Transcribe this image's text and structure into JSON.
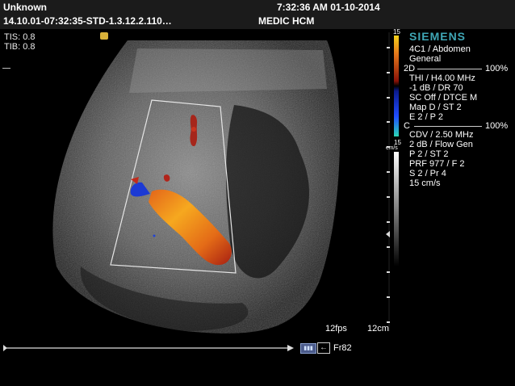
{
  "header": {
    "patient_name": "Unknown",
    "study_id": "14.10.01-07:32:35-STD-1.3.12.2.110…",
    "datetime": "7:32:36 AM 01-10-2014",
    "institution": "MEDIC HCM"
  },
  "safety": {
    "tis": "TIS: 0.8",
    "tib": "TIB: 0.8"
  },
  "branding": {
    "manufacturer": "SIEMENS",
    "brand_color": "#3fa6b5"
  },
  "scale": {
    "color_top": "15",
    "color_bottom": "15",
    "color_unit": "cm/s"
  },
  "params": {
    "transducer": "4C1 / Abdomen",
    "preset": "General",
    "mode_2d": "2D",
    "gain_2d": "100%",
    "line1": "THI / H4.00 MHz",
    "line2": "-1 dB / DR 70",
    "line3": "SC Off / DTCE M",
    "line4": "Map D / ST 2",
    "line5": "E 2 / P 2",
    "mode_c": "C",
    "gain_c": "100%",
    "c_line1": "CDV / 2.50 MHz",
    "c_line2": "2 dB / Flow Gen",
    "c_line3": "P 2 / ST 2",
    "c_line4": "PRF 977 / F 2",
    "c_line5": "S 2 / Pr 4",
    "c_line6": "15 cm/s"
  },
  "footer": {
    "frame_rate": "12fps",
    "depth": "12cm",
    "frame": "Fr82"
  },
  "icons": [
    "probe-orientation-icon",
    "cine-icon",
    "back-arrow-icon"
  ],
  "colors": {
    "flow_red": "#b2261a",
    "flow_orange": "#f29a1f",
    "flow_blue": "#1b38d6",
    "text": "#ffffff"
  }
}
